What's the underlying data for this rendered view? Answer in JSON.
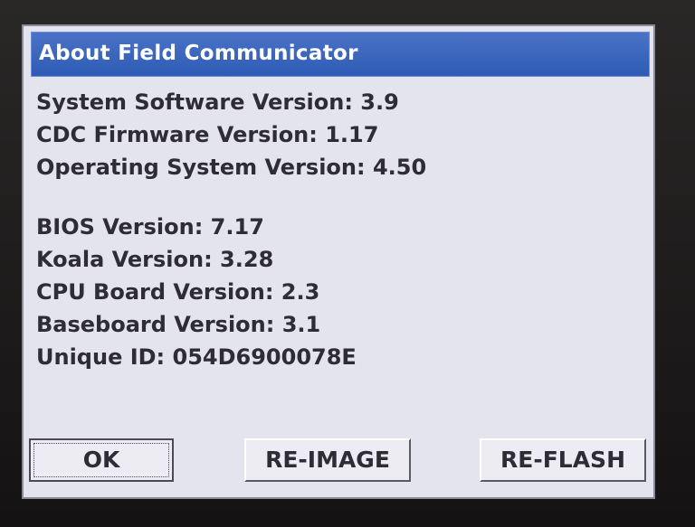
{
  "window": {
    "title": "About Field Communicator"
  },
  "info": {
    "system_software": "System Software Version: 3.9",
    "cdc_firmware": "CDC Firmware Version: 1.17",
    "operating_system": "Operating System Version: 4.50",
    "bios": "BIOS Version: 7.17",
    "koala": "Koala Version: 3.28",
    "cpu_board": "CPU Board Version: 2.3",
    "baseboard": "Baseboard Version: 3.1",
    "unique_id": "Unique ID: 054D6900078E"
  },
  "buttons": {
    "ok": "OK",
    "reimage": "RE-IMAGE",
    "reflash": "RE-FLASH"
  },
  "colors": {
    "titlebar": "#2e5bb4",
    "window_bg": "#e4e4ee",
    "text": "#2e2c36"
  }
}
